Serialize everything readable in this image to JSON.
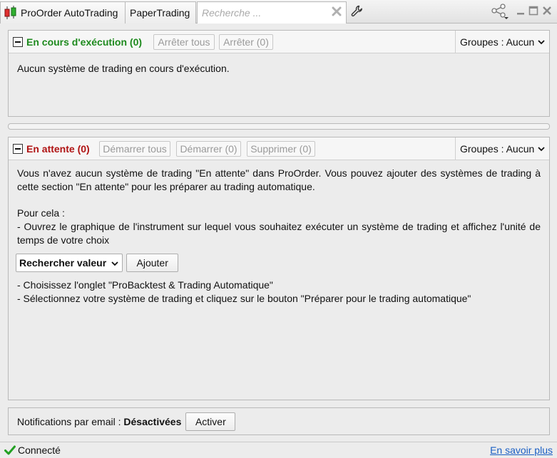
{
  "tabs": [
    {
      "label": "ProOrder AutoTrading"
    },
    {
      "label": "PaperTrading"
    }
  ],
  "search": {
    "placeholder": "Recherche ..."
  },
  "running": {
    "title": "En cours d'exécution (0)",
    "stop_all": "Arrêter tous",
    "stop": "Arrêter (0)",
    "groups_label": "Groupes : Aucun",
    "message": "Aucun système de trading en cours d'exécution."
  },
  "pending": {
    "title": "En attente (0)",
    "start_all": "Démarrer tous",
    "start": "Démarrer (0)",
    "delete": "Supprimer (0)",
    "groups_label": "Groupes : Aucun",
    "intro": "Vous n'avez aucun système de trading \"En attente\" dans ProOrder. Vous pouvez ajouter des systèmes de trading à cette section \"En attente\" pour les préparer au trading automatique.",
    "howto": "Pour cela :",
    "step1": "- Ouvrez le graphique de l'instrument sur lequel vous souhaitez exécuter un système de trading et affichez l'unité de temps de votre choix",
    "search_value": "Rechercher valeur",
    "add_button": "Ajouter",
    "step2": "- Choisissez l'onglet \"ProBacktest & Trading Automatique\"",
    "step3": "- Sélectionnez votre système de trading et cliquez sur le bouton \"Préparer pour le trading automatique\""
  },
  "notifications": {
    "label": "Notifications par email : ",
    "status": "Désactivées",
    "activate": "Activer"
  },
  "status": {
    "connection": "Connecté",
    "learn_more": "En savoir plus"
  },
  "colors": {
    "running_title": "#1e8a1e",
    "pending_title": "#b01414",
    "link": "#1a5fc4"
  }
}
